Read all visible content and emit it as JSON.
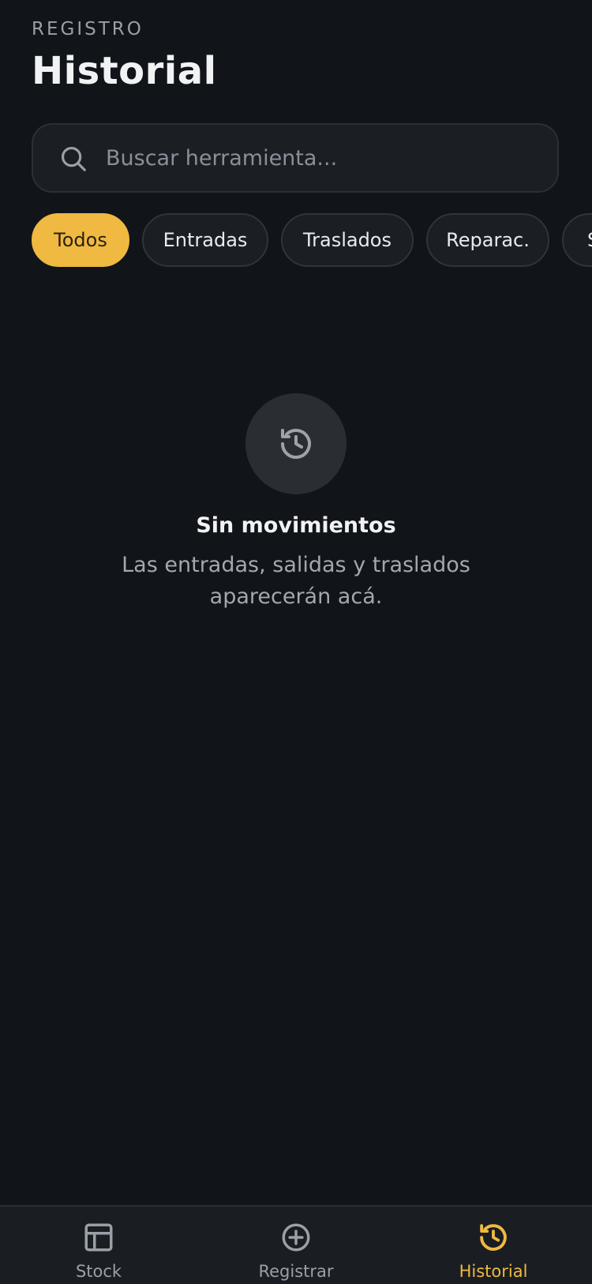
{
  "header": {
    "eyebrow": "REGISTRO",
    "title": "Historial"
  },
  "search": {
    "placeholder": "Buscar herramienta...",
    "value": ""
  },
  "filters": [
    {
      "label": "Todos",
      "active": true
    },
    {
      "label": "Entradas",
      "active": false
    },
    {
      "label": "Traslados",
      "active": false
    },
    {
      "label": "Reparac.",
      "active": false
    },
    {
      "label": "S",
      "active": false
    }
  ],
  "empty_state": {
    "icon": "history-icon",
    "title": "Sin movimientos",
    "description": "Las entradas, salidas y traslados aparecerán acá."
  },
  "tabbar": {
    "tabs": [
      {
        "label": "Stock",
        "icon": "layout-icon",
        "active": false
      },
      {
        "label": "Registrar",
        "icon": "plus-circle-icon",
        "active": false
      },
      {
        "label": "Historial",
        "icon": "history-icon",
        "active": true
      }
    ]
  },
  "colors": {
    "background": "#111419",
    "surface": "#1b1f24",
    "accent": "#f0b941",
    "text_primary": "#f1f2f4",
    "text_secondary": "#9aa0a8"
  }
}
